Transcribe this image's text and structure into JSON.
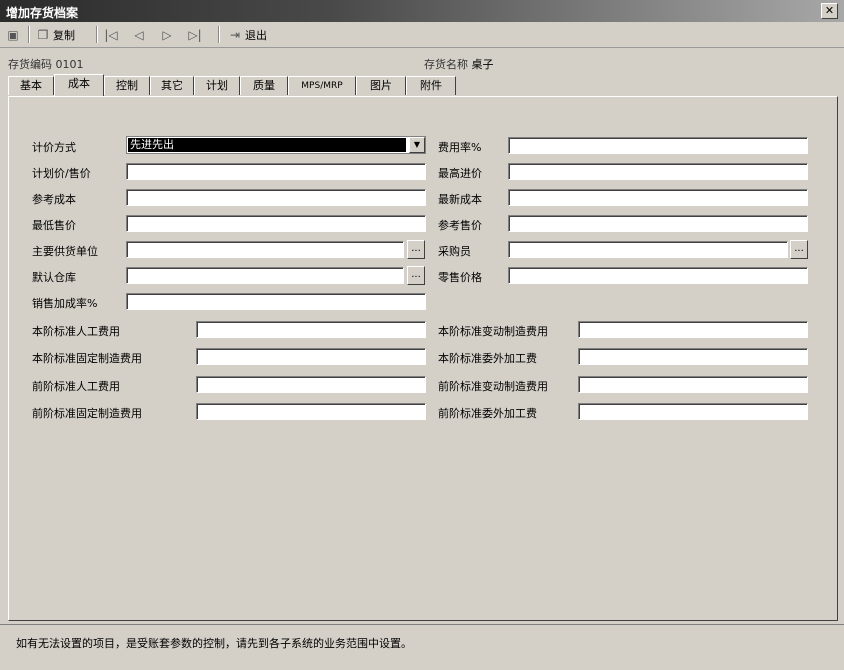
{
  "window": {
    "title": "增加存货档案"
  },
  "toolbar": {
    "copy_label": "复制",
    "exit_label": "退出"
  },
  "header": {
    "code_label": "存货编码",
    "code_value": "0101",
    "name_label": "存货名称",
    "name_value": "桌子"
  },
  "tabs": [
    {
      "label": "基本"
    },
    {
      "label": "成本"
    },
    {
      "label": "控制"
    },
    {
      "label": "其它"
    },
    {
      "label": "计划"
    },
    {
      "label": "质量"
    },
    {
      "label": "MPS/MRP"
    },
    {
      "label": "图片"
    },
    {
      "label": "附件"
    }
  ],
  "form": {
    "pricing_method_label": "计价方式",
    "pricing_method_value": "先进先出",
    "planned_price_label": "计划价/售价",
    "reference_cost_label": "参考成本",
    "min_sale_price_label": "最低售价",
    "main_supplier_label": "主要供货单位",
    "default_warehouse_label": "默认仓库",
    "sales_markup_label": "销售加成率%",
    "expense_rate_label": "费用率%",
    "max_purchase_price_label": "最高进价",
    "latest_cost_label": "最新成本",
    "reference_sale_price_label": "参考售价",
    "buyer_label": "采购员",
    "retail_price_label": "零售价格",
    "cur_std_labor_label": "本阶标准人工费用",
    "cur_std_var_mfg_label": "本阶标准变动制造费用",
    "cur_std_fixed_mfg_label": "本阶标准固定制造费用",
    "cur_std_outsource_label": "本阶标准委外加工费",
    "prev_std_labor_label": "前阶标准人工费用",
    "prev_std_var_mfg_label": "前阶标准变动制造费用",
    "prev_std_fixed_mfg_label": "前阶标准固定制造费用",
    "prev_std_outsource_label": "前阶标准委外加工费",
    "dots": "..."
  },
  "status": {
    "message": "如有无法设置的项目，是受账套参数的控制，请先到各子系统的业务范围中设置。"
  }
}
